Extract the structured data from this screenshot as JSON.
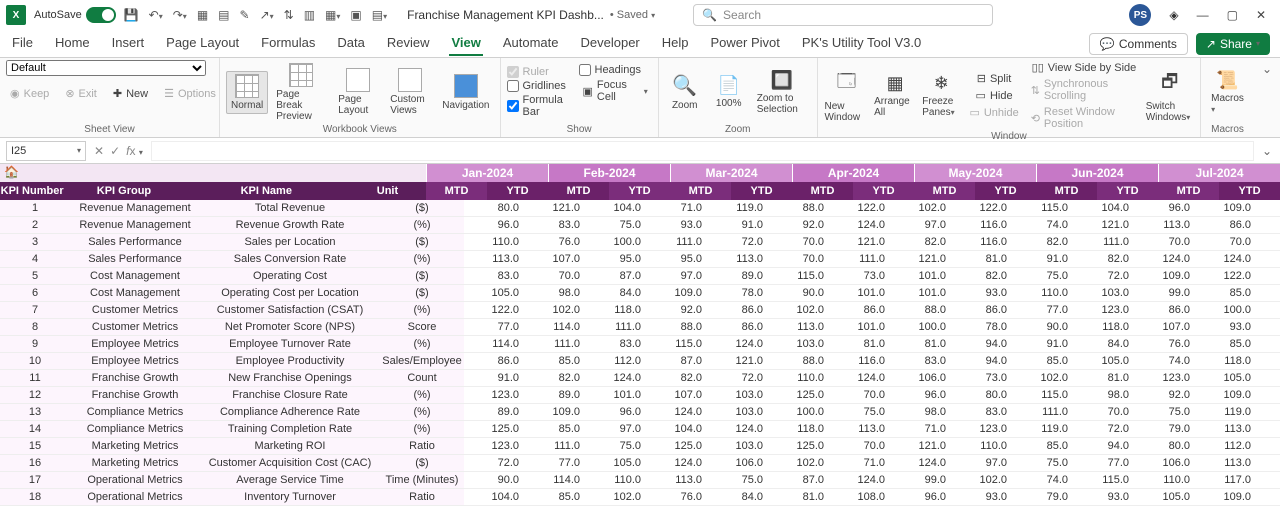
{
  "titlebar": {
    "autosave": "AutoSave",
    "toggle_state": "On",
    "filename": "Franchise Management KPI Dashb...",
    "save_state": "Saved",
    "search_placeholder": "Search",
    "avatar_initials": "PS"
  },
  "tabs": [
    "File",
    "Home",
    "Insert",
    "Page Layout",
    "Formulas",
    "Data",
    "Review",
    "View",
    "Automate",
    "Developer",
    "Help",
    "Power Pivot",
    "PK's Utility Tool V3.0"
  ],
  "tabs_active": "View",
  "comments_btn": "Comments",
  "share_btn": "Share",
  "ribbon": {
    "sheetview": {
      "default": "Default",
      "keep": "Keep",
      "exit": "Exit",
      "new": "New",
      "options": "Options",
      "label": "Sheet View"
    },
    "workbookviews": {
      "normal": "Normal",
      "pagebreak": "Page Break Preview",
      "pagelayout": "Page Layout",
      "custom": "Custom Views",
      "navigation": "Navigation",
      "label": "Workbook Views"
    },
    "show": {
      "ruler": "Ruler",
      "gridlines": "Gridlines",
      "formulabar": "Formula Bar",
      "headings": "Headings",
      "focuscell": "Focus Cell",
      "label": "Show"
    },
    "zoom": {
      "zoom": "Zoom",
      "p100": "100%",
      "tosel": "Zoom to Selection",
      "label": "Zoom"
    },
    "window": {
      "new": "New Window",
      "arrange": "Arrange All",
      "freeze": "Freeze Panes",
      "split": "Split",
      "hide": "Hide",
      "unhide": "Unhide",
      "sidebyside": "View Side by Side",
      "sync": "Synchronous Scrolling",
      "reset": "Reset Window Position",
      "switch": "Switch Windows",
      "label": "Window"
    },
    "macros": {
      "macros": "Macros",
      "label": "Macros"
    }
  },
  "namebox": "I25",
  "months": [
    "Jan-2024",
    "Feb-2024",
    "Mar-2024",
    "Apr-2024",
    "May-2024",
    "Jun-2024",
    "Jul-2024"
  ],
  "headers": {
    "kpinum": "KPI Number",
    "kpigroup": "KPI Group",
    "kpiname": "KPI Name",
    "unit": "Unit",
    "mtd": "MTD",
    "ytd": "YTD"
  },
  "rows": [
    {
      "n": "1",
      "g": "Revenue Management",
      "name": "Total Revenue",
      "u": "($)",
      "v": [
        "80.0",
        "121.0",
        "104.0",
        "71.0",
        "119.0",
        "88.0",
        "122.0",
        "102.0",
        "122.0",
        "115.0",
        "104.0",
        "96.0",
        "109.0"
      ]
    },
    {
      "n": "2",
      "g": "Revenue Management",
      "name": "Revenue Growth Rate",
      "u": "(%)",
      "v": [
        "96.0",
        "83.0",
        "75.0",
        "93.0",
        "91.0",
        "92.0",
        "124.0",
        "97.0",
        "116.0",
        "74.0",
        "121.0",
        "113.0",
        "86.0"
      ]
    },
    {
      "n": "3",
      "g": "Sales Performance",
      "name": "Sales per Location",
      "u": "($)",
      "v": [
        "110.0",
        "76.0",
        "100.0",
        "111.0",
        "72.0",
        "70.0",
        "121.0",
        "82.0",
        "116.0",
        "82.0",
        "111.0",
        "70.0",
        "70.0"
      ]
    },
    {
      "n": "4",
      "g": "Sales Performance",
      "name": "Sales Conversion Rate",
      "u": "(%)",
      "v": [
        "113.0",
        "107.0",
        "95.0",
        "95.0",
        "113.0",
        "70.0",
        "111.0",
        "121.0",
        "81.0",
        "91.0",
        "82.0",
        "124.0",
        "124.0"
      ]
    },
    {
      "n": "5",
      "g": "Cost Management",
      "name": "Operating Cost",
      "u": "($)",
      "v": [
        "83.0",
        "70.0",
        "87.0",
        "97.0",
        "89.0",
        "115.0",
        "73.0",
        "101.0",
        "82.0",
        "75.0",
        "72.0",
        "109.0",
        "122.0"
      ]
    },
    {
      "n": "6",
      "g": "Cost Management",
      "name": "Operating Cost per Location",
      "u": "($)",
      "v": [
        "105.0",
        "98.0",
        "84.0",
        "109.0",
        "78.0",
        "90.0",
        "101.0",
        "101.0",
        "93.0",
        "110.0",
        "103.0",
        "99.0",
        "85.0"
      ]
    },
    {
      "n": "7",
      "g": "Customer Metrics",
      "name": "Customer Satisfaction (CSAT)",
      "u": "(%)",
      "v": [
        "122.0",
        "102.0",
        "118.0",
        "92.0",
        "86.0",
        "102.0",
        "86.0",
        "88.0",
        "86.0",
        "77.0",
        "123.0",
        "86.0",
        "100.0"
      ]
    },
    {
      "n": "8",
      "g": "Customer Metrics",
      "name": "Net Promoter Score (NPS)",
      "u": "Score",
      "v": [
        "77.0",
        "114.0",
        "111.0",
        "88.0",
        "86.0",
        "113.0",
        "101.0",
        "100.0",
        "78.0",
        "90.0",
        "118.0",
        "107.0",
        "93.0"
      ]
    },
    {
      "n": "9",
      "g": "Employee Metrics",
      "name": "Employee Turnover Rate",
      "u": "(%)",
      "v": [
        "114.0",
        "111.0",
        "83.0",
        "115.0",
        "124.0",
        "103.0",
        "81.0",
        "81.0",
        "94.0",
        "91.0",
        "84.0",
        "76.0",
        "85.0"
      ]
    },
    {
      "n": "10",
      "g": "Employee Metrics",
      "name": "Employee Productivity",
      "u": "Sales/Employee",
      "v": [
        "86.0",
        "85.0",
        "112.0",
        "87.0",
        "121.0",
        "88.0",
        "116.0",
        "83.0",
        "94.0",
        "85.0",
        "105.0",
        "74.0",
        "118.0"
      ]
    },
    {
      "n": "11",
      "g": "Franchise Growth",
      "name": "New Franchise Openings",
      "u": "Count",
      "v": [
        "91.0",
        "82.0",
        "124.0",
        "82.0",
        "72.0",
        "110.0",
        "124.0",
        "106.0",
        "73.0",
        "102.0",
        "81.0",
        "123.0",
        "105.0"
      ]
    },
    {
      "n": "12",
      "g": "Franchise Growth",
      "name": "Franchise Closure Rate",
      "u": "(%)",
      "v": [
        "123.0",
        "89.0",
        "101.0",
        "107.0",
        "103.0",
        "125.0",
        "70.0",
        "96.0",
        "80.0",
        "115.0",
        "98.0",
        "92.0",
        "109.0"
      ]
    },
    {
      "n": "13",
      "g": "Compliance Metrics",
      "name": "Compliance Adherence Rate",
      "u": "(%)",
      "v": [
        "89.0",
        "109.0",
        "96.0",
        "124.0",
        "103.0",
        "100.0",
        "75.0",
        "98.0",
        "83.0",
        "111.0",
        "70.0",
        "75.0",
        "119.0"
      ]
    },
    {
      "n": "14",
      "g": "Compliance Metrics",
      "name": "Training Completion Rate",
      "u": "(%)",
      "v": [
        "125.0",
        "85.0",
        "97.0",
        "104.0",
        "124.0",
        "118.0",
        "113.0",
        "71.0",
        "123.0",
        "119.0",
        "72.0",
        "79.0",
        "113.0"
      ]
    },
    {
      "n": "15",
      "g": "Marketing Metrics",
      "name": "Marketing ROI",
      "u": "Ratio",
      "v": [
        "123.0",
        "111.0",
        "75.0",
        "125.0",
        "103.0",
        "125.0",
        "70.0",
        "121.0",
        "110.0",
        "85.0",
        "94.0",
        "80.0",
        "112.0"
      ]
    },
    {
      "n": "16",
      "g": "Marketing Metrics",
      "name": "Customer Acquisition Cost (CAC)",
      "u": "($)",
      "v": [
        "72.0",
        "77.0",
        "105.0",
        "124.0",
        "106.0",
        "102.0",
        "71.0",
        "124.0",
        "97.0",
        "75.0",
        "77.0",
        "106.0",
        "113.0"
      ]
    },
    {
      "n": "17",
      "g": "Operational Metrics",
      "name": "Average Service Time",
      "u": "Time (Minutes)",
      "v": [
        "90.0",
        "114.0",
        "110.0",
        "113.0",
        "75.0",
        "87.0",
        "124.0",
        "99.0",
        "102.0",
        "74.0",
        "115.0",
        "110.0",
        "117.0"
      ]
    },
    {
      "n": "18",
      "g": "Operational Metrics",
      "name": "Inventory Turnover",
      "u": "Ratio",
      "v": [
        "104.0",
        "85.0",
        "102.0",
        "76.0",
        "84.0",
        "81.0",
        "108.0",
        "96.0",
        "93.0",
        "79.0",
        "93.0",
        "105.0",
        "109.0"
      ]
    }
  ]
}
